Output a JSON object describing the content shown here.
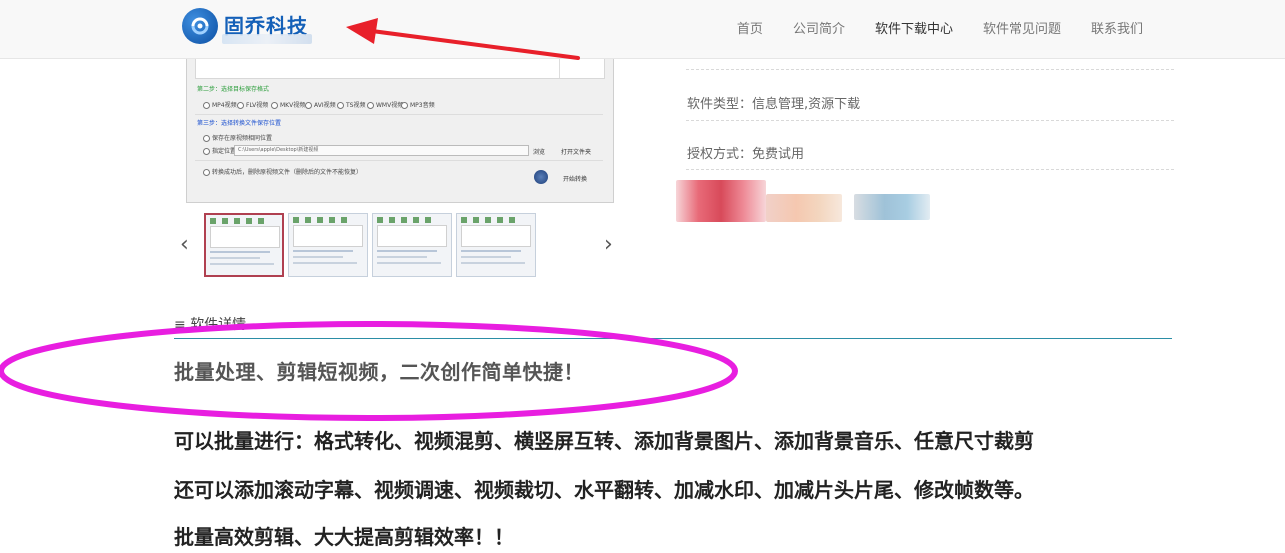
{
  "header": {
    "logo_text": "固乔科技",
    "nav": [
      {
        "label": "首页"
      },
      {
        "label": "公司简介"
      },
      {
        "label": "软件下载中心",
        "active": true
      },
      {
        "label": "软件常见问题"
      },
      {
        "label": "联系我们"
      }
    ]
  },
  "preview": {
    "step2_label": "第二步：选择目标保存格式",
    "formats": [
      "MP4视频",
      "FLV视频",
      "MKV视频",
      "AVI视频",
      "TS视频",
      "WMV视频",
      "MP3音频"
    ],
    "step3_label": "第三步：选择转换文件保存位置",
    "save_original": "保存在原视频相同位置",
    "save_custom": "指定位置",
    "save_path": "C:\\Users\\apple\\Desktop\\新建视频",
    "browse_label": "浏览",
    "open_folder_label": "打开文件夹",
    "after_label": "转换成功后，删除原视频文件（删除后的文件不能恢复）",
    "start_label": "开始转换"
  },
  "info": {
    "software_type": "软件类型：信息管理,资源下载",
    "license": "授权方式：免费试用"
  },
  "thumbnails": {
    "count": 4,
    "selected_index": 0,
    "prev_glyph": "‹",
    "next_glyph": "›"
  },
  "details": {
    "heading_icon": "≡",
    "heading": "软件详情",
    "slogan": "批量处理、剪辑短视频，二次创作简单快捷！",
    "paragraphs": [
      "可以批量进行：格式转化、视频混剪、横竖屏互转、添加背景图片、添加背景音乐、任意尺寸裁剪",
      "还可以添加滚动字幕、视频调速、视频裁切、水平翻转、加减水印、加减片头片尾、修改帧数等。",
      "批量高效剪辑、大大提高剪辑效率！！"
    ]
  },
  "colors": {
    "accent_line": "#2b8ea6",
    "annotation_arrow": "#e8202a",
    "annotation_ellipse": "#e81ee0",
    "logo_blue": "#1460b8"
  }
}
